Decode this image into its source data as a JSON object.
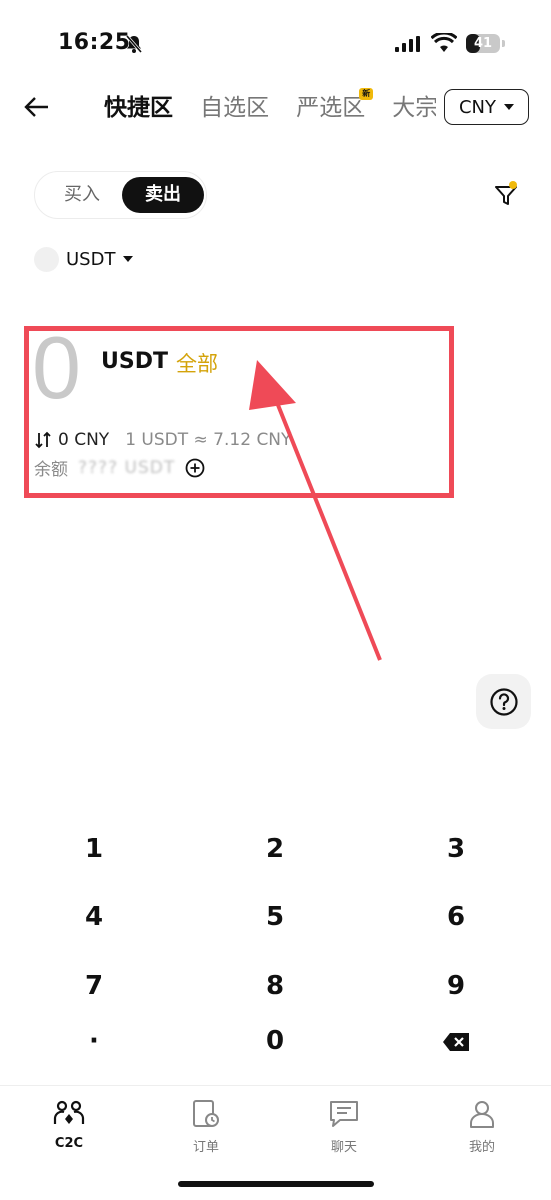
{
  "status_bar": {
    "time": "16:25",
    "battery_level": "41",
    "battery_fraction": 0.41
  },
  "nav": {
    "tabs": [
      {
        "label": "快捷区",
        "active": true
      },
      {
        "label": "自选区",
        "active": false
      },
      {
        "label": "严选区",
        "active": false,
        "badge": "新"
      },
      {
        "label": "大宗",
        "active": false
      }
    ],
    "currency": "CNY"
  },
  "trade": {
    "buy_label": "买入",
    "sell_label": "卖出",
    "selected": "sell"
  },
  "coin": {
    "symbol": "USDT"
  },
  "amount": {
    "value": "0",
    "unit": "USDT",
    "all_label": "全部",
    "converted": "0 CNY",
    "rate": "1 USDT ≈ 7.12 CNY",
    "balance_label": "余额",
    "balance_value": "???? USDT"
  },
  "keypad": {
    "keys": [
      "1",
      "2",
      "3",
      "4",
      "5",
      "6",
      "7",
      "8",
      "9",
      "·",
      "0"
    ]
  },
  "bottom_nav": {
    "items": [
      {
        "label": "C2C",
        "icon": "c2c-icon",
        "active": true
      },
      {
        "label": "订单",
        "icon": "orders-icon",
        "active": false
      },
      {
        "label": "聊天",
        "icon": "chat-icon",
        "active": false
      },
      {
        "label": "我的",
        "icon": "profile-icon",
        "active": false
      }
    ]
  },
  "colors": {
    "accent": "#f0b90b",
    "link": "#d4a30a",
    "annotation": "#ef4a57"
  }
}
